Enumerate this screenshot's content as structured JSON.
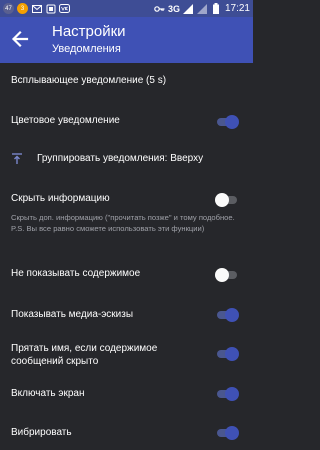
{
  "status_bar": {
    "badges": [
      "47",
      "3"
    ],
    "network": "3G",
    "time": "17:21"
  },
  "header": {
    "title": "Настройки",
    "subtitle": "Уведомления"
  },
  "settings": {
    "popup": {
      "label": "Всплывающее уведомление (5 s)"
    },
    "color": {
      "label": "Цветовое уведомление",
      "enabled": true
    },
    "group": {
      "label": "Группировать уведомления: Вверху"
    },
    "hide_info": {
      "label": "Скрыть информацию",
      "description": "Скрыть доп. информацию (\"прочитать позже\" и тому подобное. P.S. Вы все равно сможете использовать эти функции)",
      "enabled": false
    },
    "hide_content": {
      "label": "Не показывать содержимое",
      "enabled": false
    },
    "media": {
      "label": "Показывать медиа-эскизы",
      "enabled": true
    },
    "hide_name": {
      "label_line1": "Прятать имя, если содержимое",
      "label_line2": "сообщений скрыто",
      "enabled": true
    },
    "screen": {
      "label": "Включать экран",
      "enabled": true
    },
    "vibrate": {
      "label": "Вибрировать",
      "enabled": true
    }
  },
  "colors": {
    "accent": "#3f51b5",
    "statusbar": "#3e4d95",
    "background": "#26272b",
    "description": "#9fa1a8"
  }
}
